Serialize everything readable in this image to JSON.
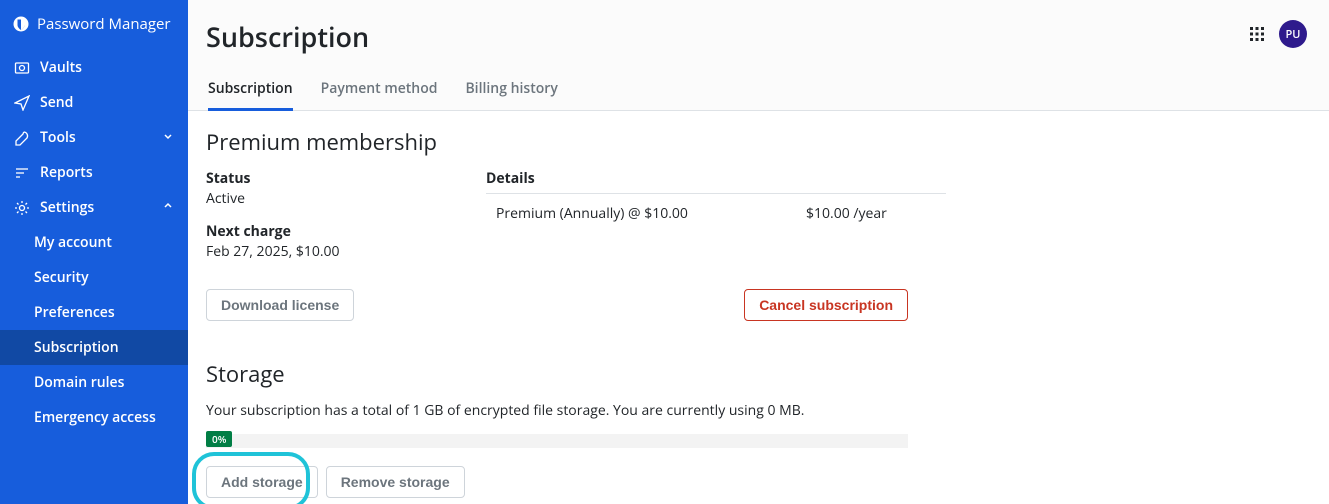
{
  "app": {
    "name": "Password Manager",
    "avatar_initials": "PU"
  },
  "sidebar": {
    "items": [
      {
        "label": "Vaults"
      },
      {
        "label": "Send"
      },
      {
        "label": "Tools"
      },
      {
        "label": "Reports"
      },
      {
        "label": "Settings"
      }
    ],
    "settings_children": [
      {
        "label": "My account"
      },
      {
        "label": "Security"
      },
      {
        "label": "Preferences"
      },
      {
        "label": "Subscription"
      },
      {
        "label": "Domain rules"
      },
      {
        "label": "Emergency access"
      }
    ]
  },
  "header": {
    "title": "Subscription",
    "tabs": [
      {
        "label": "Subscription"
      },
      {
        "label": "Payment method"
      },
      {
        "label": "Billing history"
      }
    ]
  },
  "membership": {
    "section_title": "Premium membership",
    "status_label": "Status",
    "status_value": "Active",
    "next_charge_label": "Next charge",
    "next_charge_value": "Feb 27, 2025, $10.00",
    "details_label": "Details",
    "detail_item": "Premium (Annually) @ $10.00",
    "detail_price": "$10.00 /year",
    "download_license": "Download license",
    "cancel_subscription": "Cancel subscription"
  },
  "storage": {
    "section_title": "Storage",
    "description": "Your subscription has a total of 1 GB of encrypted file storage. You are currently using 0 MB.",
    "percent_label": "0%",
    "add_storage": "Add storage",
    "remove_storage": "Remove storage"
  }
}
